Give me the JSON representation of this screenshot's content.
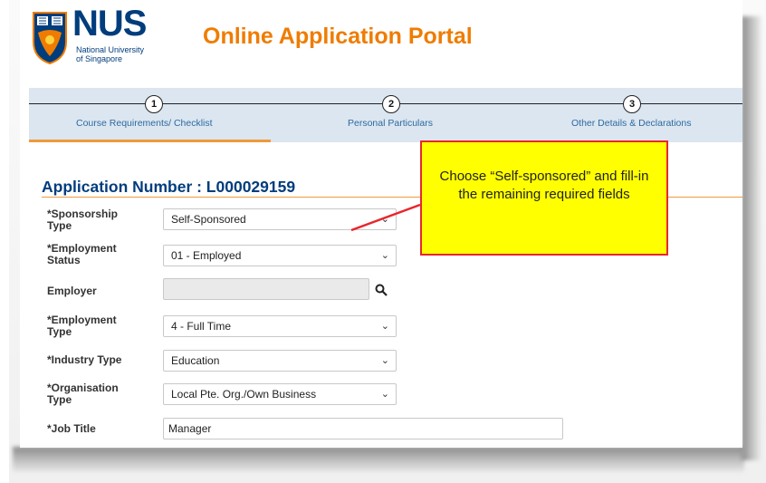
{
  "header": {
    "logo_word": "NUS",
    "logo_subtitle_line1": "National University",
    "logo_subtitle_line2": "of Singapore",
    "portal_title": "Online Application Portal"
  },
  "stepper": {
    "steps": [
      {
        "number": "1",
        "label": "Course Requirements/ Checklist"
      },
      {
        "number": "2",
        "label": "Personal Particulars"
      },
      {
        "number": "3",
        "label": "Other Details & Declarations"
      }
    ],
    "active_step": 1
  },
  "application": {
    "number_label": "Application Number : L000029159"
  },
  "form": {
    "sponsorship_type": {
      "label_line1": "*Sponsorship",
      "label_line2": "Type",
      "value": "Self-Sponsored"
    },
    "employment_status": {
      "label_line1": "*Employment",
      "label_line2": "Status",
      "value": "01 - Employed"
    },
    "employer": {
      "label": "Employer",
      "value": ""
    },
    "employment_type": {
      "label_line1": "*Employment",
      "label_line2": "Type",
      "value": "4 - Full Time"
    },
    "industry_type": {
      "label": "*Industry Type",
      "value": "Education"
    },
    "organisation_type": {
      "label_line1": "*Organisation",
      "label_line2": "Type",
      "value": "Local Pte. Org./Own Business"
    },
    "job_title": {
      "label": "*Job Title",
      "value": "Manager"
    }
  },
  "annotation": {
    "text": "Choose “Self-sponsored” and fill-in the remaining required fields"
  },
  "colors": {
    "brand_blue": "#003d7c",
    "brand_orange": "#ef7c00",
    "stepper_bg": "#dbe6f1",
    "callout_bg": "#ffff00",
    "callout_border": "#e8262e"
  }
}
